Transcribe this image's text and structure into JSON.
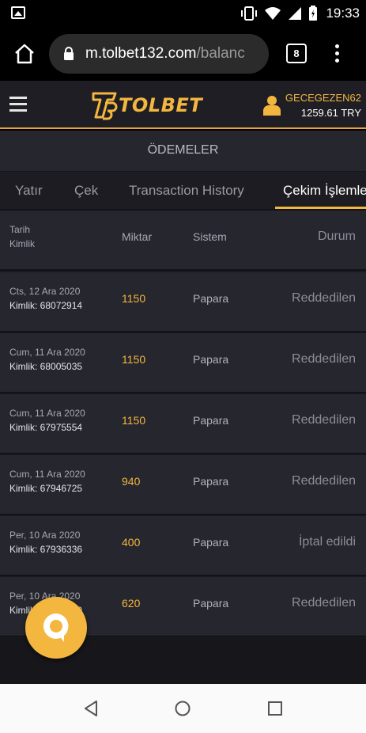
{
  "status_bar": {
    "time": "19:33"
  },
  "browser": {
    "url_host": "m.tolbet132.com",
    "url_path": "/balanc",
    "tab_count": "8"
  },
  "header": {
    "logo_text": "TOLBET",
    "username": "GECEGEZEN62",
    "balance": "1259.61 TRY"
  },
  "page_title": "ÖDEMELER",
  "tabs": [
    {
      "label": "Yatır",
      "active": false
    },
    {
      "label": "Çek",
      "active": false
    },
    {
      "label": "Transaction History",
      "active": false
    },
    {
      "label": "Çekim İşlemleri",
      "active": true
    }
  ],
  "table": {
    "headers": {
      "date": "Tarih",
      "id": "Kimlik",
      "amount": "Miktar",
      "system": "Sistem",
      "status": "Durum"
    },
    "rows": [
      {
        "date": "Cts, 12 Ara 2020",
        "id": "Kimlik: 68072914",
        "amount": "1150",
        "system": "Papara",
        "status": "Reddedilen"
      },
      {
        "date": "Cum, 11 Ara 2020",
        "id": "Kimlik: 68005035",
        "amount": "1150",
        "system": "Papara",
        "status": "Reddedilen"
      },
      {
        "date": "Cum, 11 Ara 2020",
        "id": "Kimlik: 67975554",
        "amount": "1150",
        "system": "Papara",
        "status": "Reddedilen"
      },
      {
        "date": "Cum, 11 Ara 2020",
        "id": "Kimlik: 67946725",
        "amount": "940",
        "system": "Papara",
        "status": "Reddedilen"
      },
      {
        "date": "Per, 10 Ara 2020",
        "id": "Kimlik: 67936336",
        "amount": "400",
        "system": "Papara",
        "status": "İptal edildi"
      },
      {
        "date": "Per, 10 Ara 2020",
        "id": "Kimlik: 67936330",
        "amount": "620",
        "system": "Papara",
        "status": "Reddedilen"
      }
    ]
  },
  "colors": {
    "accent": "#f3b63f",
    "header_bg": "#1e1e24",
    "row_bg": "#26262e"
  },
  "icons": {
    "home": "home-icon",
    "lock": "lock-icon",
    "menu": "more-vert-icon",
    "hamburger": "hamburger-icon",
    "user": "user-icon",
    "chat": "chat-icon"
  }
}
